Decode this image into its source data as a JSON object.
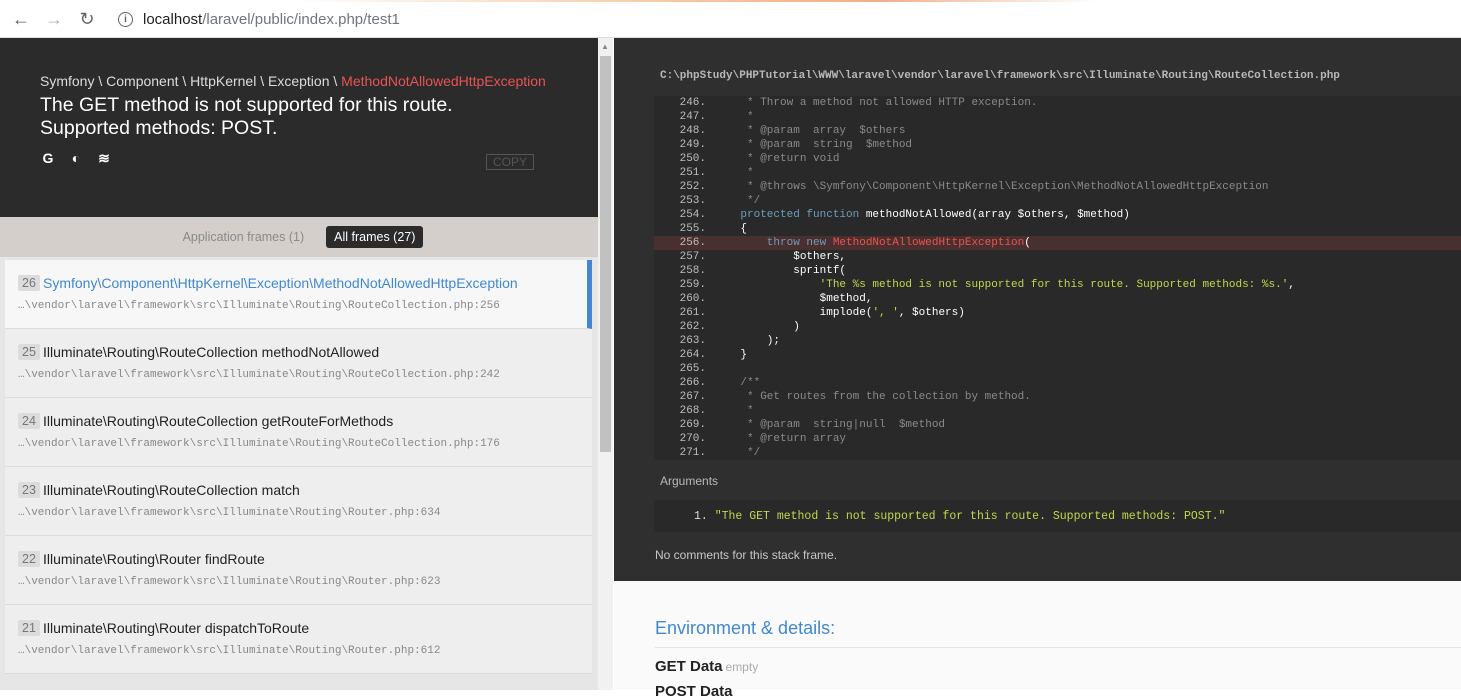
{
  "browser": {
    "url_host": "localhost",
    "url_path": "/laravel/public/index.php/test1",
    "back_glyph": "←",
    "forward_glyph": "→",
    "reload_glyph": "↻",
    "info_glyph": "i"
  },
  "exception": {
    "namespace": "Symfony \\ Component \\ HttpKernel \\ Exception \\ ",
    "class_name": "MethodNotAllowedHttpException",
    "message_line1": "The GET method is not supported for this route.",
    "message_line2": "Supported methods: POST.",
    "icons": [
      "google-icon",
      "duckduckgo-icon",
      "stackoverflow-icon"
    ],
    "icon_glyphs": [
      "G",
      "◐",
      "≋"
    ],
    "copy_label": "COPY"
  },
  "tabs": {
    "application": "Application frames (1)",
    "all": "All frames (27)"
  },
  "frames": [
    {
      "num": "26",
      "cls": "Symfony\\Component\\HttpKernel\\Exception\\MethodNotAllowedHttpException",
      "file": "…\\vendor\\laravel\\framework\\src\\Illuminate\\Routing\\RouteCollection.php:256",
      "active": true
    },
    {
      "num": "25",
      "cls": "Illuminate\\Routing\\RouteCollection methodNotAllowed",
      "file": "…\\vendor\\laravel\\framework\\src\\Illuminate\\Routing\\RouteCollection.php:242",
      "active": false
    },
    {
      "num": "24",
      "cls": "Illuminate\\Routing\\RouteCollection getRouteForMethods",
      "file": "…\\vendor\\laravel\\framework\\src\\Illuminate\\Routing\\RouteCollection.php:176",
      "active": false
    },
    {
      "num": "23",
      "cls": "Illuminate\\Routing\\RouteCollection match",
      "file": "…\\vendor\\laravel\\framework\\src\\Illuminate\\Routing\\Router.php:634",
      "active": false
    },
    {
      "num": "22",
      "cls": "Illuminate\\Routing\\Router findRoute",
      "file": "…\\vendor\\laravel\\framework\\src\\Illuminate\\Routing\\Router.php:623",
      "active": false
    },
    {
      "num": "21",
      "cls": "Illuminate\\Routing\\Router dispatchToRoute",
      "file": "…\\vendor\\laravel\\framework\\src\\Illuminate\\Routing\\Router.php:612",
      "active": false
    }
  ],
  "code": {
    "file_path": "C:\\phpStudy\\PHPTutorial\\WWW\\laravel\\vendor\\laravel\\framework\\src\\Illuminate\\Routing\\RouteCollection.php",
    "lines": [
      {
        "n": "246.",
        "parts": [
          [
            "c-com",
            "     * Throw a method not allowed HTTP exception."
          ]
        ]
      },
      {
        "n": "247.",
        "parts": [
          [
            "c-com",
            "     *"
          ]
        ]
      },
      {
        "n": "248.",
        "parts": [
          [
            "c-com",
            "     * @param  array  $others"
          ]
        ]
      },
      {
        "n": "249.",
        "parts": [
          [
            "c-com",
            "     * @param  string  $method"
          ]
        ]
      },
      {
        "n": "250.",
        "parts": [
          [
            "c-com",
            "     * @return void"
          ]
        ]
      },
      {
        "n": "251.",
        "parts": [
          [
            "c-com",
            "     *"
          ]
        ]
      },
      {
        "n": "252.",
        "parts": [
          [
            "c-com",
            "     * @throws \\Symfony\\Component\\HttpKernel\\Exception\\MethodNotAllowedHttpException"
          ]
        ]
      },
      {
        "n": "253.",
        "parts": [
          [
            "c-com",
            "     */"
          ]
        ]
      },
      {
        "n": "254.",
        "parts": [
          [
            "c-kw",
            "    protected function "
          ],
          [
            "",
            "methodNotAllowed(array $others, $method)"
          ]
        ]
      },
      {
        "n": "255.",
        "parts": [
          [
            "",
            "    {"
          ]
        ]
      },
      {
        "n": "256.",
        "hl": true,
        "parts": [
          [
            "c-kw",
            "        throw new "
          ],
          [
            "c-cls",
            "MethodNotAllowedHttpException"
          ],
          [
            "",
            "("
          ]
        ]
      },
      {
        "n": "257.",
        "parts": [
          [
            "",
            "            $others,"
          ]
        ]
      },
      {
        "n": "258.",
        "parts": [
          [
            "",
            "            sprintf("
          ]
        ]
      },
      {
        "n": "259.",
        "parts": [
          [
            "c-str",
            "                'The %s method is not supported for this route. Supported methods: %s.'"
          ],
          [
            "",
            ","
          ]
        ]
      },
      {
        "n": "260.",
        "parts": [
          [
            "",
            "                $method,"
          ]
        ]
      },
      {
        "n": "261.",
        "parts": [
          [
            "",
            "                implode("
          ],
          [
            "c-str",
            "', '"
          ],
          [
            "",
            ", $others)"
          ]
        ]
      },
      {
        "n": "262.",
        "parts": [
          [
            "",
            "            )"
          ]
        ]
      },
      {
        "n": "263.",
        "parts": [
          [
            "",
            "        );"
          ]
        ]
      },
      {
        "n": "264.",
        "parts": [
          [
            "",
            "    }"
          ]
        ]
      },
      {
        "n": "265.",
        "parts": [
          [
            "",
            ""
          ]
        ]
      },
      {
        "n": "266.",
        "parts": [
          [
            "c-com",
            "    /**"
          ]
        ]
      },
      {
        "n": "267.",
        "parts": [
          [
            "c-com",
            "     * Get routes from the collection by method."
          ]
        ]
      },
      {
        "n": "268.",
        "parts": [
          [
            "c-com",
            "     *"
          ]
        ]
      },
      {
        "n": "269.",
        "parts": [
          [
            "c-com",
            "     * @param  string|null  $method"
          ]
        ]
      },
      {
        "n": "270.",
        "parts": [
          [
            "c-com",
            "     * @return array"
          ]
        ]
      },
      {
        "n": "271.",
        "parts": [
          [
            "c-com",
            "     */"
          ]
        ]
      }
    ]
  },
  "arguments": {
    "title": "Arguments",
    "item_index": "1.",
    "item_value": "\"The GET method is not supported for this route. Supported methods: POST.\""
  },
  "no_comments": "No comments for this stack frame.",
  "environment": {
    "title": "Environment & details:",
    "get_label": "GET Data",
    "get_value": "empty",
    "post_label": "POST Data"
  },
  "colors": {
    "accent": "#4288ce",
    "exception_red": "#e95353",
    "dark_bg": "#2f2f2f"
  }
}
